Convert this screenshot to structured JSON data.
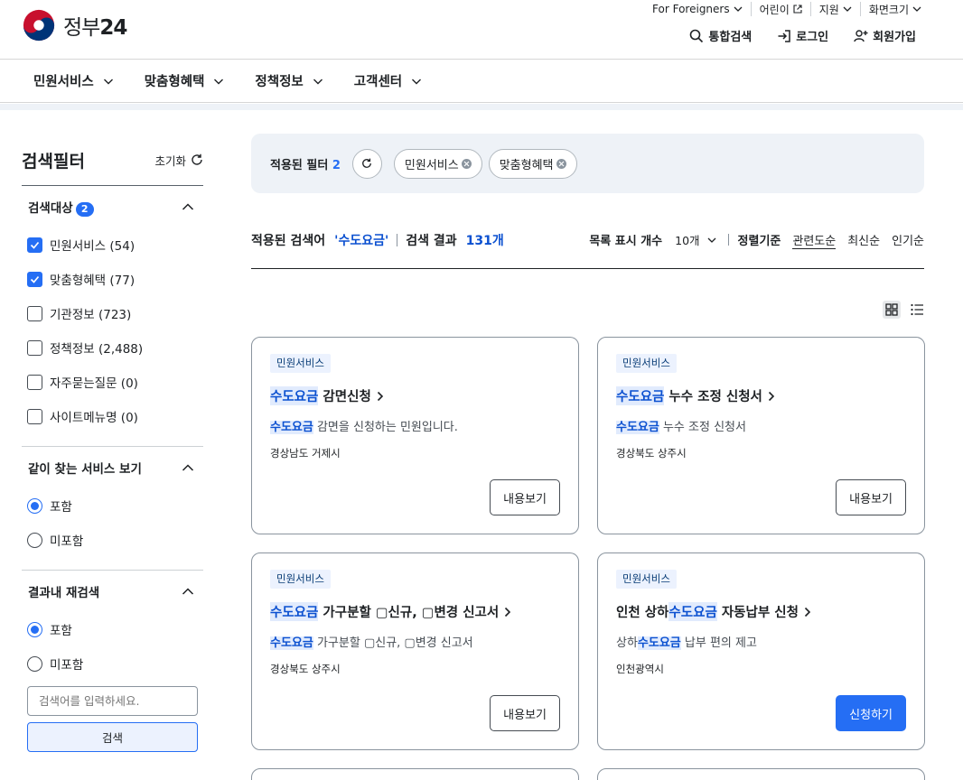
{
  "header": {
    "logo_text": "정부",
    "logo_num": "24",
    "util": [
      "For Foreigners",
      "어린이",
      "지원",
      "화면크기"
    ],
    "quick": {
      "search": "통합검색",
      "login": "로그인",
      "signup": "회원가입"
    }
  },
  "gnb": [
    "민원서비스",
    "맞춤형혜택",
    "정책정보",
    "고객센터"
  ],
  "filter": {
    "title": "검색필터",
    "reset": "초기화",
    "target": {
      "label": "검색대상",
      "badge": "2",
      "options": [
        {
          "label": "민원서비스 (54)",
          "checked": true
        },
        {
          "label": "맞춤형혜택 (77)",
          "checked": true
        },
        {
          "label": "기관정보 (723)",
          "checked": false
        },
        {
          "label": "정책정보 (2,488)",
          "checked": false
        },
        {
          "label": "자주묻는질문 (0)",
          "checked": false
        },
        {
          "label": "사이트메뉴명 (0)",
          "checked": false
        }
      ]
    },
    "together": {
      "label": "같이 찾는 서비스 보기",
      "options": [
        "포함",
        "미포함"
      ],
      "selected": 0
    },
    "within": {
      "label": "결과내 재검색",
      "options": [
        "포함",
        "미포함"
      ],
      "selected": 0,
      "placeholder": "검색어를 입력하세요.",
      "button": "검색"
    }
  },
  "applied": {
    "label": "적용된 필터",
    "count": "2",
    "chips": [
      "민원서비스",
      "맞춤형혜택"
    ]
  },
  "summary": {
    "keyword_label": "적용된 검색어",
    "keyword": "'수도요금'",
    "result_label": "검색 결과",
    "result_count": "131개",
    "list_label": "목록 표시 개수",
    "list_value": "10개",
    "sort_label": "정렬기준",
    "sorts": [
      "관련도순",
      "최신순",
      "인기순"
    ],
    "active_sort": 0
  },
  "cards": [
    {
      "tag": "민원서비스",
      "title_parts": [
        {
          "t": "수도요금",
          "hl": true
        },
        {
          "t": " 감면신청",
          "hl": false
        }
      ],
      "desc_parts": [
        {
          "t": "수도요금",
          "hl": true
        },
        {
          "t": " 감면을 신청하는 민원입니다.",
          "hl": false
        }
      ],
      "org": "경상남도 거제시",
      "button": "내용보기",
      "primary": false
    },
    {
      "tag": "민원서비스",
      "title_parts": [
        {
          "t": "수도요금",
          "hl": true
        },
        {
          "t": " 누수 조정 신청서",
          "hl": false
        }
      ],
      "desc_parts": [
        {
          "t": "수도요금",
          "hl": true
        },
        {
          "t": " 누수 조정 신청서",
          "hl": false
        }
      ],
      "org": "경상북도 상주시",
      "button": "내용보기",
      "primary": false
    },
    {
      "tag": "민원서비스",
      "title_parts": [
        {
          "t": "수도요금",
          "hl": true
        },
        {
          "t": " 가구분할 ▢신규, ▢변경 신고서",
          "hl": false
        }
      ],
      "desc_parts": [
        {
          "t": "수도요금",
          "hl": true
        },
        {
          "t": " 가구분할 ▢신규, ▢변경 신고서",
          "hl": false
        }
      ],
      "org": "경상북도 상주시",
      "button": "내용보기",
      "primary": false
    },
    {
      "tag": "민원서비스",
      "title_parts": [
        {
          "t": "인천 상하",
          "hl": false
        },
        {
          "t": "수도요금",
          "hl": true
        },
        {
          "t": " 자동납부 신청",
          "hl": false
        }
      ],
      "desc_parts": [
        {
          "t": "상하",
          "hl": false
        },
        {
          "t": "수도요금",
          "hl": true
        },
        {
          "t": " 납부 편의 제고",
          "hl": false
        }
      ],
      "org": "인천광역시",
      "button": "신청하기",
      "primary": true
    }
  ],
  "colors": {
    "primary": "#256ef4",
    "highlight_bg": "#e1ebfd",
    "highlight_text": "#0b50d0",
    "tag_bg": "#ecf2fe"
  }
}
